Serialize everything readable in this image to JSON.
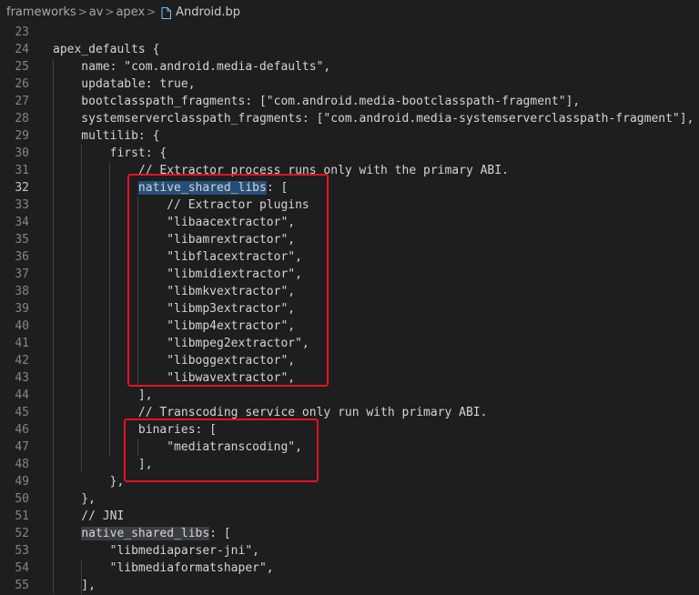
{
  "breadcrumb": {
    "items": [
      "frameworks",
      "av",
      "apex"
    ],
    "separator": ">",
    "file": "Android.bp"
  },
  "editor": {
    "active_line": "32",
    "lines": [
      {
        "num": "23",
        "text": ""
      },
      {
        "num": "24",
        "text": "apex_defaults {"
      },
      {
        "num": "25",
        "text": "    name: \"com.android.media-defaults\","
      },
      {
        "num": "26",
        "text": "    updatable: true,"
      },
      {
        "num": "27",
        "text": "    bootclasspath_fragments: [\"com.android.media-bootclasspath-fragment\"],"
      },
      {
        "num": "28",
        "text": "    systemserverclasspath_fragments: [\"com.android.media-systemserverclasspath-fragment\"],"
      },
      {
        "num": "29",
        "text": "    multilib: {"
      },
      {
        "num": "30",
        "text": "        first: {"
      },
      {
        "num": "31",
        "text": "            // Extractor process runs only with the primary ABI."
      },
      {
        "num": "32",
        "pre": "            ",
        "hl": "native_shared_libs",
        "hl_type": "strong",
        "post": ": ["
      },
      {
        "num": "33",
        "text": "                // Extractor plugins"
      },
      {
        "num": "34",
        "text": "                \"libaacextractor\","
      },
      {
        "num": "35",
        "text": "                \"libamrextractor\","
      },
      {
        "num": "36",
        "text": "                \"libflacextractor\","
      },
      {
        "num": "37",
        "text": "                \"libmidiextractor\","
      },
      {
        "num": "38",
        "text": "                \"libmkvextractor\","
      },
      {
        "num": "39",
        "text": "                \"libmp3extractor\","
      },
      {
        "num": "40",
        "text": "                \"libmp4extractor\","
      },
      {
        "num": "41",
        "text": "                \"libmpeg2extractor\","
      },
      {
        "num": "42",
        "text": "                \"liboggextractor\","
      },
      {
        "num": "43",
        "text": "                \"libwavextractor\","
      },
      {
        "num": "44",
        "text": "            ],"
      },
      {
        "num": "45",
        "text": "            // Transcoding service only run with primary ABI."
      },
      {
        "num": "46",
        "text": "            binaries: ["
      },
      {
        "num": "47",
        "text": "                \"mediatranscoding\","
      },
      {
        "num": "48",
        "text": "            ],"
      },
      {
        "num": "49",
        "text": "        },"
      },
      {
        "num": "50",
        "text": "    },"
      },
      {
        "num": "51",
        "text": "    // JNI"
      },
      {
        "num": "52",
        "pre": "    ",
        "hl": "native_shared_libs",
        "hl_type": "weak",
        "post": ": ["
      },
      {
        "num": "53",
        "text": "        \"libmediaparser-jni\","
      },
      {
        "num": "54",
        "text": "        \"libmediaformatshaper\","
      },
      {
        "num": "55",
        "text": "    ],"
      }
    ]
  },
  "colors": {
    "background": "#1e1e1e",
    "selection": "#264f78",
    "word_highlight": "#3a3d41",
    "annotation_box": "#e81123"
  }
}
